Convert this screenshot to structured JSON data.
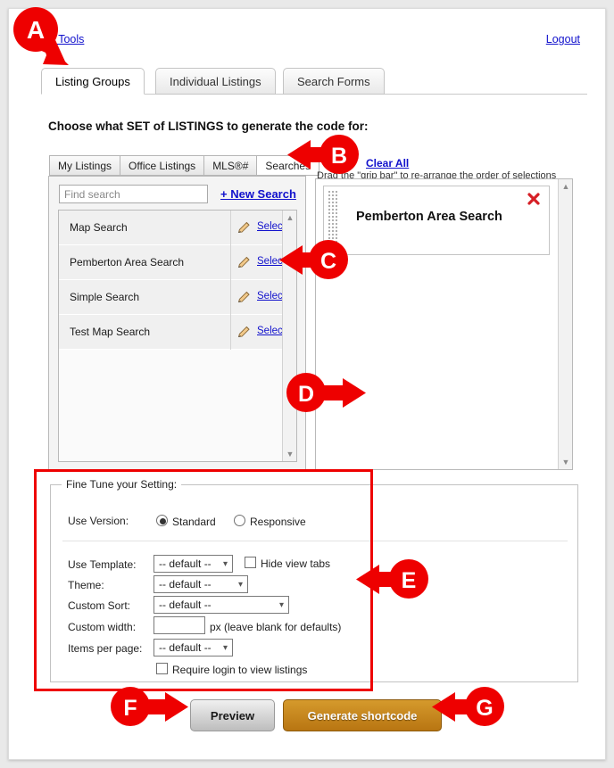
{
  "top": {
    "tools_link": "g Tools",
    "logout_link": "Logout"
  },
  "main_tabs": [
    {
      "label": "Listing Groups",
      "active": true
    },
    {
      "label": "Individual Listings",
      "active": false
    },
    {
      "label": "Search Forms",
      "active": false
    }
  ],
  "heading": "Choose what SET of LISTINGS to generate the code for:",
  "inner_tabs": [
    {
      "label": "My Listings",
      "active": false
    },
    {
      "label": "Office Listings",
      "active": false
    },
    {
      "label": "MLS®#",
      "active": false
    },
    {
      "label": "Searches",
      "active": true
    }
  ],
  "selector": {
    "clear_all": "Clear All",
    "grip_hint": "Drag the \"grip bar\" to re-arrange the order of selections",
    "find_placeholder": "Find search",
    "find_value": "",
    "new_search": "+ New Search",
    "rows": [
      {
        "name": "Map Search",
        "select_label": "Select »"
      },
      {
        "name": "Pemberton Area Search",
        "select_label": "Select »"
      },
      {
        "name": "Simple Search",
        "select_label": "Select »"
      },
      {
        "name": "Test Map Search",
        "select_label": "Select »"
      }
    ]
  },
  "selection": {
    "items": [
      {
        "title": "Pemberton Area Search"
      }
    ]
  },
  "fine_tune": {
    "legend": "Fine Tune your Setting:",
    "use_version_label": "Use Version:",
    "version_options": [
      {
        "label": "Standard",
        "checked": true
      },
      {
        "label": "Responsive",
        "checked": false
      }
    ],
    "use_template_label": "Use Template:",
    "use_template_value": "-- default --",
    "hide_view_tabs_label": "Hide view tabs",
    "hide_view_tabs_checked": false,
    "theme_label": "Theme:",
    "theme_value": "-- default --",
    "custom_sort_label": "Custom Sort:",
    "custom_sort_value": "-- default --",
    "custom_width_label": "Custom width:",
    "custom_width_value": "",
    "custom_width_suffix": "px (leave blank for defaults)",
    "items_per_page_label": "Items per page:",
    "items_per_page_value": "-- default --",
    "require_login_label": "Require login to view listings",
    "require_login_checked": false
  },
  "buttons": {
    "preview": "Preview",
    "generate": "Generate shortcode"
  },
  "annotations": [
    {
      "letter": "A",
      "target": "listing-groups-tab"
    },
    {
      "letter": "B",
      "target": "searches-inner-tab"
    },
    {
      "letter": "C",
      "target": "pemberton-select-link"
    },
    {
      "letter": "D",
      "target": "selection-panel"
    },
    {
      "letter": "E",
      "target": "fine-tune-panel"
    },
    {
      "letter": "F",
      "target": "preview-button"
    },
    {
      "letter": "G",
      "target": "generate-shortcode-button"
    }
  ],
  "colors": {
    "annotation_red": "#ee0000",
    "link_blue": "#1111cc",
    "generate_orange": "#c8851c"
  }
}
